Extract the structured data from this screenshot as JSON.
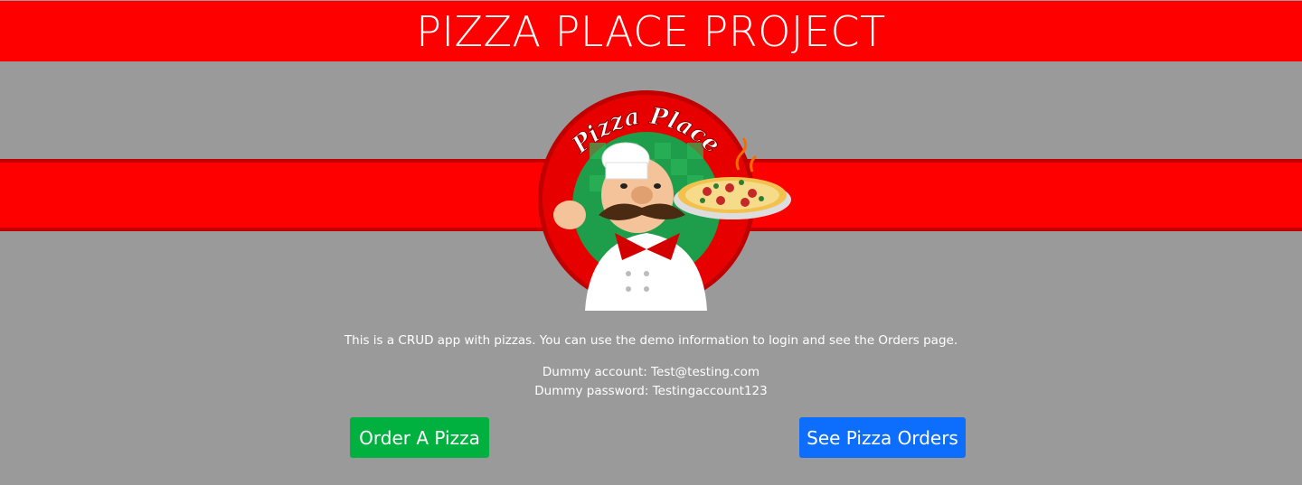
{
  "header": {
    "title": "PIZZA PLACE PROJECT"
  },
  "logo": {
    "text": "Pizza Place",
    "icon": "pizza-chef-logo"
  },
  "intro": {
    "description": "This is a CRUD app with pizzas. You can use the demo information to login and see the Orders page.",
    "account_line": "Dummy account: Test@testing.com",
    "password_line": "Dummy password: Testingaccount123"
  },
  "actions": {
    "order_label": "Order A Pizza",
    "orders_label": "See Pizza Orders"
  },
  "colors": {
    "brand_red": "#ff0000",
    "background": "#9a9a9a",
    "order_green": "#00b140",
    "orders_blue": "#0d6efd"
  }
}
